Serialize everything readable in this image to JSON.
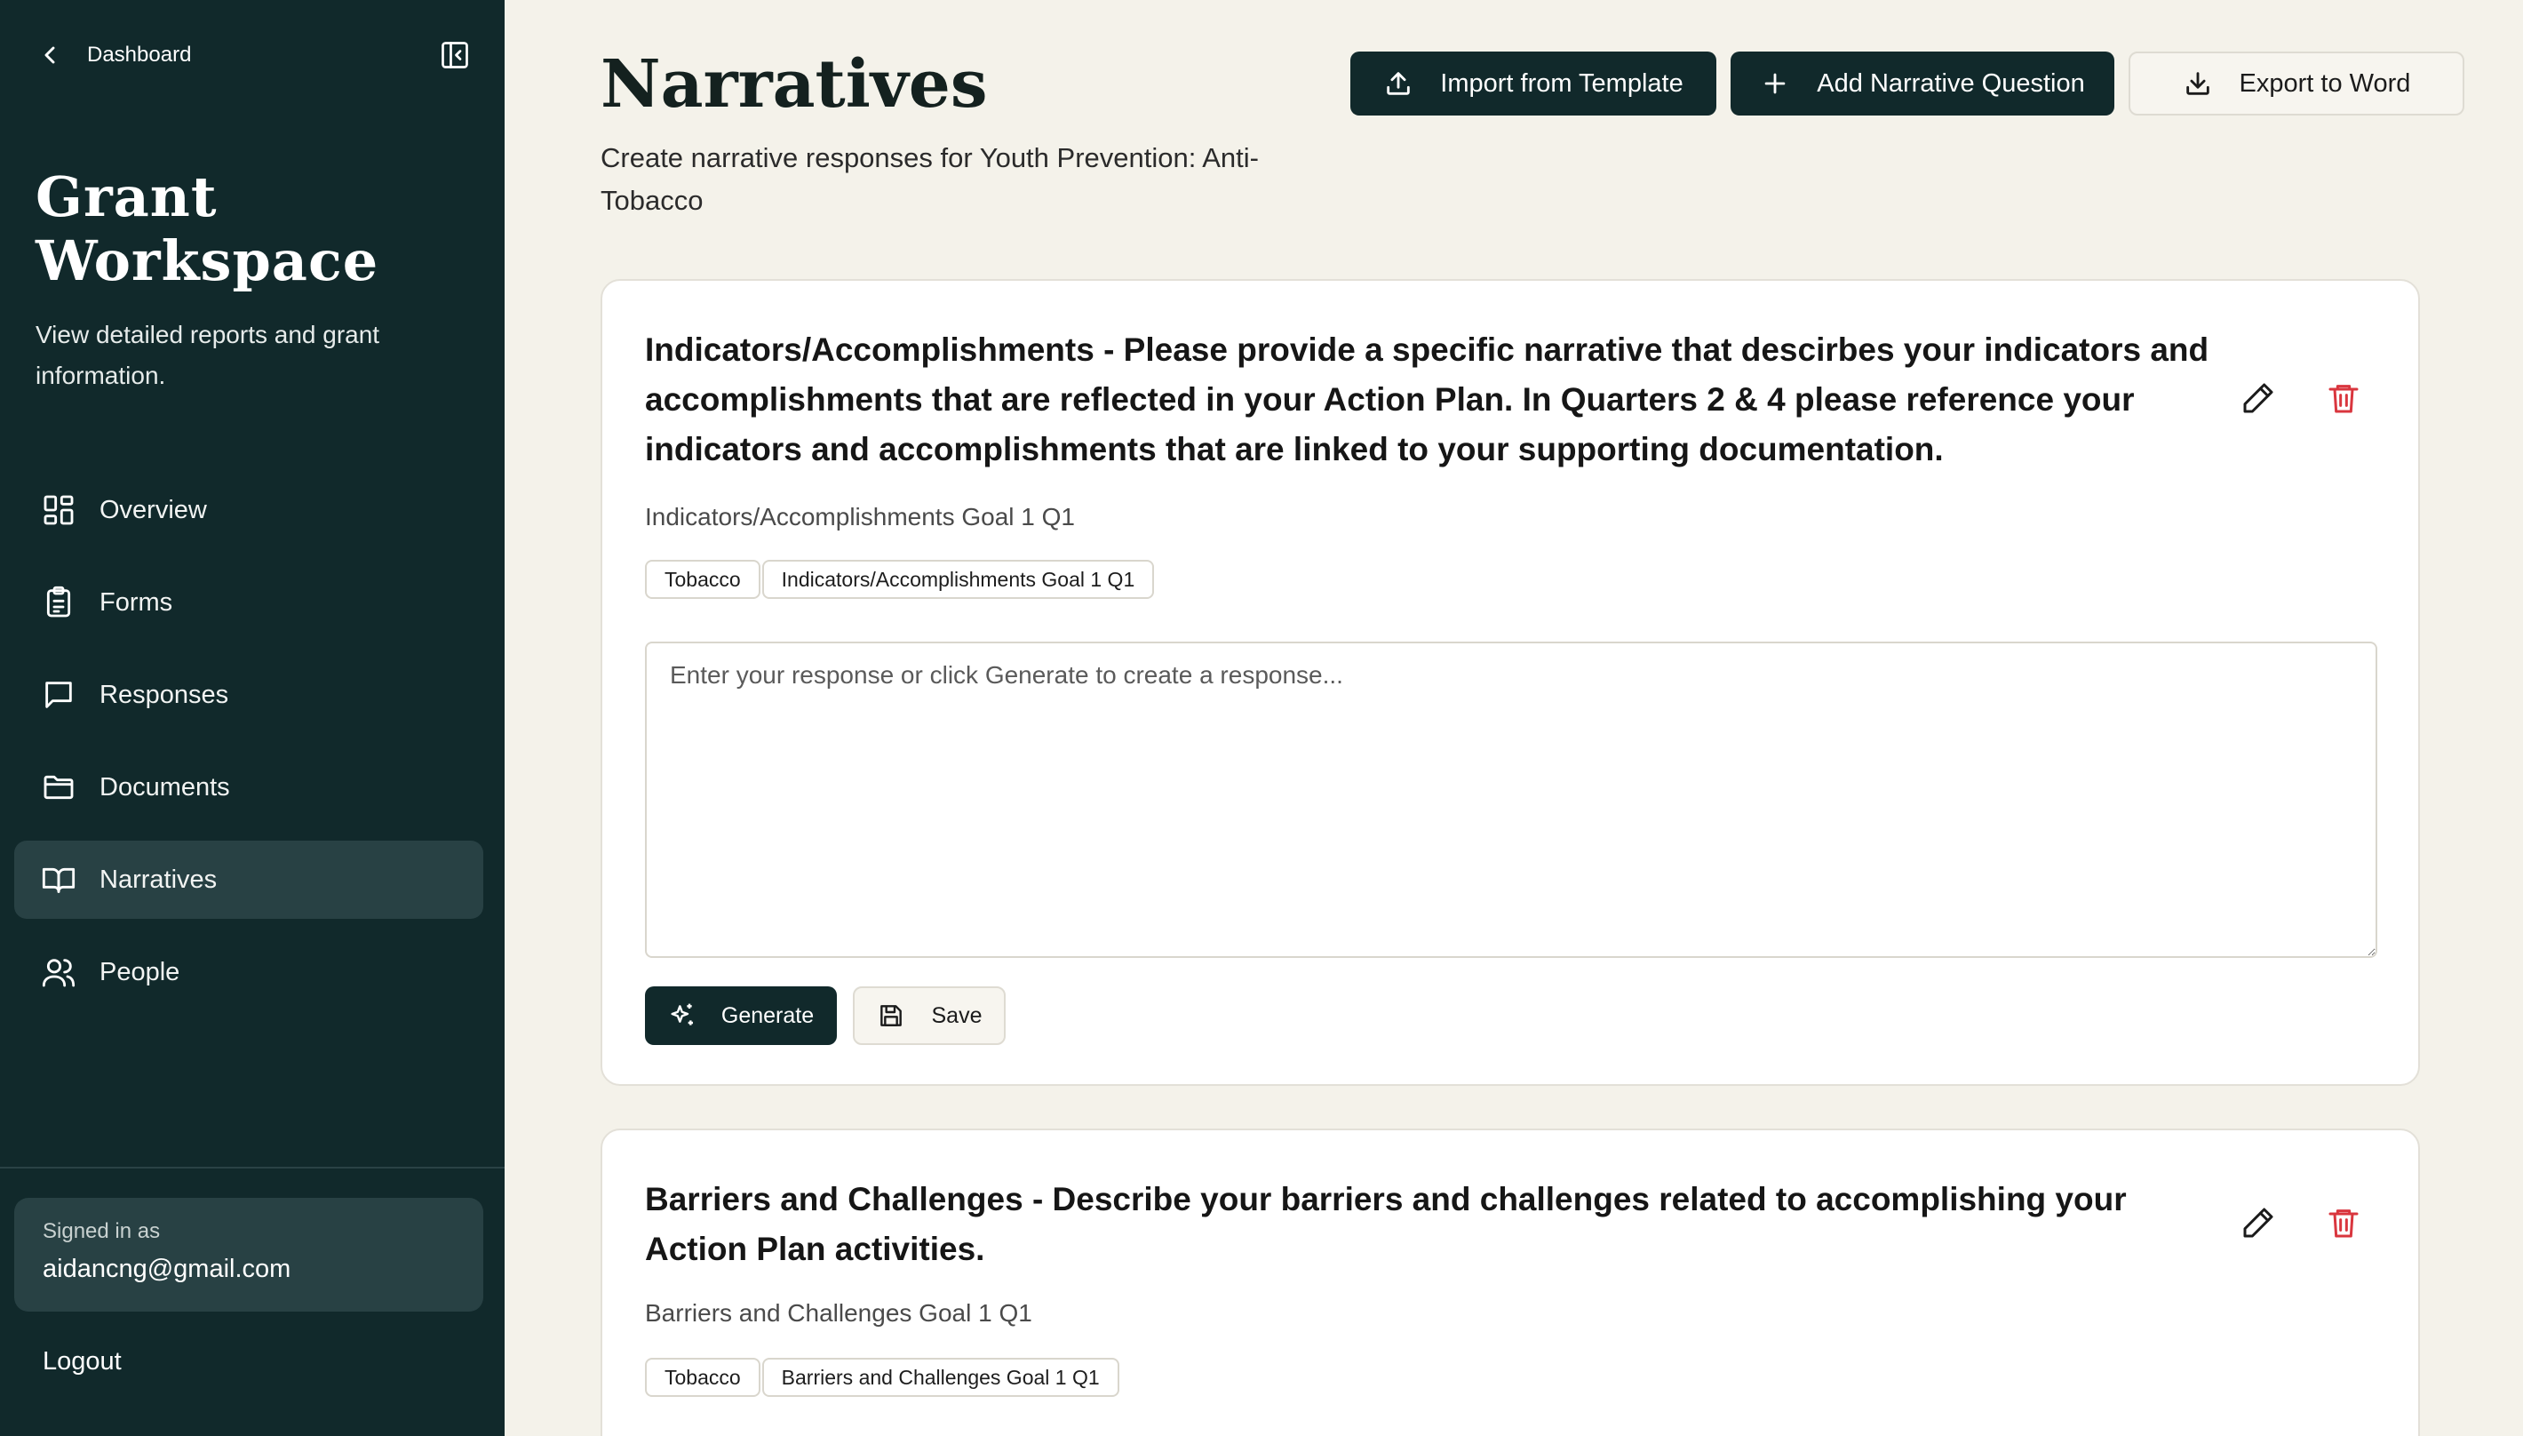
{
  "sidebar": {
    "back_label": "Dashboard",
    "title_line1": "Grant",
    "title_line2": "Workspace",
    "description": "View detailed reports and grant information.",
    "items": [
      {
        "label": "Overview",
        "icon": "overview-icon"
      },
      {
        "label": "Forms",
        "icon": "clipboard-icon"
      },
      {
        "label": "Responses",
        "icon": "message-icon"
      },
      {
        "label": "Documents",
        "icon": "folder-icon"
      },
      {
        "label": "Narratives",
        "icon": "book-icon",
        "active": true
      },
      {
        "label": "People",
        "icon": "users-icon"
      }
    ],
    "signed_in_label": "Signed in as",
    "email": "aidancng@gmail.com",
    "logout_label": "Logout"
  },
  "header": {
    "title": "Narratives",
    "subtitle": "Create narrative responses for Youth Prevention: Anti-Tobacco",
    "import_label": "Import from Template",
    "add_label": "Add Narrative Question",
    "export_label": "Export to Word"
  },
  "questions": [
    {
      "text": "Indicators/Accomplishments - Please provide a specific narrative that descirbes your indicators and accomplishments that are reflected in your Action Plan. In Quarters 2 & 4 please reference your indicators and accomplishments that are linked to your supporting documentation.",
      "subtitle": "Indicators/Accomplishments Goal 1 Q1",
      "tags": [
        "Tobacco",
        "Indicators/Accomplishments Goal 1 Q1"
      ],
      "response_value": "",
      "response_placeholder": "Enter your response or click Generate to create a response...",
      "generate_label": "Generate",
      "save_label": "Save"
    },
    {
      "text": "Barriers and Challenges - Describe your barriers and challenges related to accomplishing your Action Plan activities.",
      "subtitle": "Barriers and Challenges Goal 1 Q1",
      "tags": [
        "Tobacco",
        "Barriers and Challenges Goal 1 Q1"
      ]
    }
  ],
  "colors": {
    "sidebar_bg": "#11292b",
    "active_item_bg": "#284144",
    "page_bg": "#f4f2ea",
    "delete_red": "#d9363e"
  }
}
